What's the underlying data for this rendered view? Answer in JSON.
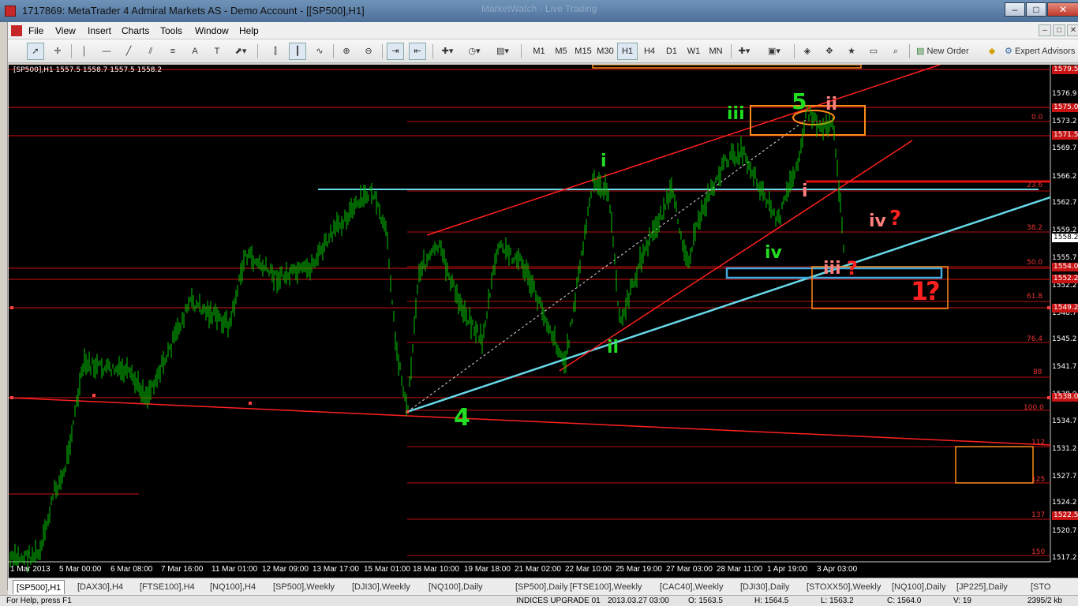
{
  "window": {
    "title": "1717869: MetaTrader 4 Admiral Markets AS - Demo Account - [[SP500],H1]",
    "ghost_title": "MarketWatch - Live Trading"
  },
  "window_controls": {
    "minimize": "–",
    "maximize": "□",
    "close": "✕"
  },
  "menu": [
    "File",
    "View",
    "Insert",
    "Charts",
    "Tools",
    "Window",
    "Help"
  ],
  "toolbar": {
    "timeframes": [
      "M1",
      "M5",
      "M15",
      "M30",
      "H1",
      "H4",
      "D1",
      "W1",
      "MN"
    ],
    "selected_timeframe": "H1",
    "new_order": "New Order",
    "expert_advisors": "Expert Advisors"
  },
  "chart": {
    "info": "[SP500],H1  1557.5 1558.7 1557.5 1558.2",
    "current_price": "1558.2",
    "price_axis": [
      "1576.9",
      "1573.2",
      "1569.7",
      "1566.2",
      "1562.7",
      "1559.2",
      "1555.7",
      "1552.2",
      "1548.7",
      "1545.2",
      "1541.7",
      "1538.0",
      "1534.7",
      "1531.2",
      "1527.7",
      "1524.2",
      "1520.7",
      "1517.2"
    ],
    "red_price_tags": [
      "1579.5",
      "1575.0",
      "1571.5",
      "1554.0",
      "1552.2",
      "1549.2",
      "1538.0",
      "1522.5"
    ],
    "fib_levels": [
      "0.0",
      "23.6",
      "38.2",
      "50.0",
      "61.8",
      "76.4",
      "88",
      "100.0",
      "112",
      "125",
      "137",
      "150"
    ],
    "time_axis": [
      "1 Mar 2013",
      "5 Mar 00:00",
      "6 Mar 08:00",
      "7 Mar 16:00",
      "11 Mar 01:00",
      "12 Mar 09:00",
      "13 Mar 17:00",
      "15 Mar 01:00",
      "18 Mar 10:00",
      "19 Mar 18:00",
      "21 Mar 02:00",
      "22 Mar 10:00",
      "25 Mar 19:00",
      "27 Mar 03:00",
      "28 Mar 11:00",
      "1 Apr 19:00",
      "3 Apr 03:00"
    ],
    "wave_labels": {
      "w4": "4",
      "w5": "5",
      "wi": "i",
      "wii": "ii",
      "wiii": "iii",
      "wiv": "iv",
      "ri": "i",
      "rii": "ii",
      "riii": "iii",
      "riv": "iv",
      "q1": "?",
      "q2": "?",
      "r1": "1",
      "q3": "?"
    },
    "colors": {
      "bull": "#00c800",
      "level": "#e01010",
      "trend": "#ff2020",
      "cyan": "#66d9e8",
      "orange": "#ff8c1a",
      "green_label": "#22dd22",
      "pink_label": "#ff8080"
    }
  },
  "symbol_tabs": [
    "[SP500],H1",
    "[DAX30],H4",
    "[FTSE100],H4",
    "[NQ100],H4",
    "[SP500],Weekly",
    "[DJI30],Weekly",
    "[NQ100],Daily",
    "[SP500],Daily",
    "[FTSE100],Weekly",
    "[CAC40],Weekly",
    "[DJI30],Daily",
    "[STOXX50],Weekly",
    "[NQ100],Daily",
    "[JP225],Daily",
    "[STO"
  ],
  "status": {
    "help": "For Help, press F1",
    "profile": "INDICES UPGRADE 01",
    "datetime": "2013.03.27 03:00",
    "open": "O: 1563.5",
    "high": "H: 1564.5",
    "low": "L: 1563.2",
    "close": "C: 1564.0",
    "volume": "V: 19",
    "traffic": "2395/2 kb"
  }
}
